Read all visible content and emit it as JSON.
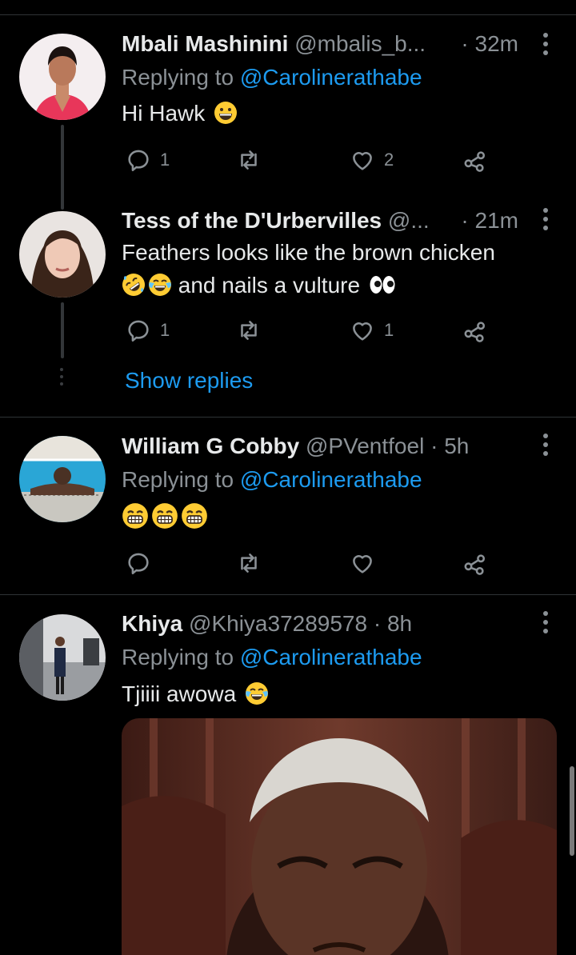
{
  "colors": {
    "background": "#000000",
    "text": "#e7e9ea",
    "muted": "#8b9196",
    "link": "#1d9bf0",
    "divider": "#2f3336"
  },
  "tweets": [
    {
      "name": "Mbali Mashinini",
      "handle": "@mbalis_b...",
      "time": "· 32m",
      "reply_prefix": "Replying to ",
      "reply_handle": "@Carolinerathabe",
      "text_line1": "Hi Hawk",
      "emojis": [
        "grinning-face"
      ],
      "counts": {
        "replies": "1",
        "likes": "2"
      }
    },
    {
      "name": "Tess of the D'Urbervilles",
      "handle": "@...",
      "time": "· 21m",
      "text_line1": "Feathers looks like the brown chicken",
      "text_line2": "and nails a vulture",
      "emojis": [
        "rolling-on-floor-laughing",
        "face-with-tears-of-joy",
        "eyes"
      ],
      "counts": {
        "replies": "1",
        "likes": "1"
      },
      "show_replies": "Show replies"
    },
    {
      "name": "William G Cobby",
      "handle": "@PVentfoel",
      "time": "· 5h",
      "reply_prefix": "Replying to ",
      "reply_handle": "@Carolinerathabe",
      "emojis": [
        "beaming-face",
        "beaming-face",
        "beaming-face"
      ]
    },
    {
      "name": "Khiya",
      "handle": "@Khiya37289578",
      "time": "· 8h",
      "reply_prefix": "Replying to ",
      "reply_handle": "@Carolinerathabe",
      "text_line1": "Tjiiii awowa",
      "emojis": [
        "face-with-tears-of-joy"
      ]
    }
  ],
  "icons": [
    "reply-icon",
    "retweet-icon",
    "like-icon",
    "share-icon",
    "more-icon"
  ]
}
